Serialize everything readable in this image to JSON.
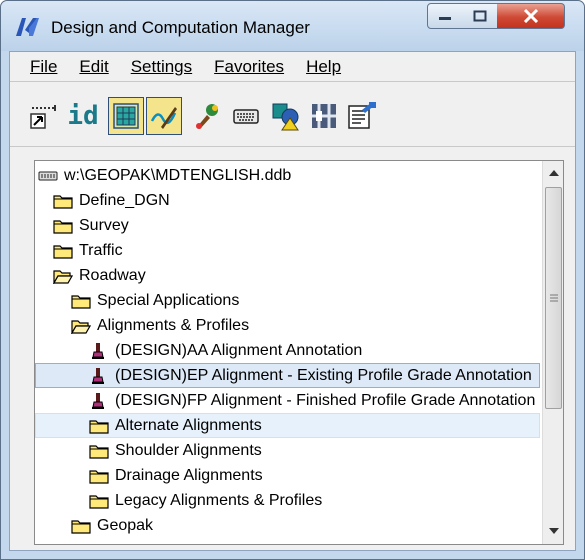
{
  "window": {
    "title": "Design and Computation Manager",
    "controls": [
      "minimize",
      "maximize",
      "close"
    ]
  },
  "menu": [
    {
      "label": "File"
    },
    {
      "label": "Edit"
    },
    {
      "label": "Settings"
    },
    {
      "label": "Favorites"
    },
    {
      "label": "Help"
    }
  ],
  "toolbar": {
    "id_label": "id",
    "buttons": [
      "place-element-icon",
      "id-icon",
      "dialog-icon",
      "draw-mode-icon",
      "paint-icon",
      "keyboard-icon",
      "shapes-icon",
      "grid-icon",
      "properties-icon"
    ],
    "active": [
      "dialog-icon",
      "draw-mode-icon"
    ]
  },
  "tree": {
    "items": [
      {
        "label": "w:\\GEOPAK\\MDTENGLISH.ddb",
        "icon": "database-icon",
        "level": 0
      },
      {
        "label": "Define_DGN",
        "icon": "folder-closed-icon",
        "level": 1
      },
      {
        "label": "Survey",
        "icon": "folder-closed-icon",
        "level": 1
      },
      {
        "label": "Traffic",
        "icon": "folder-closed-icon",
        "level": 1
      },
      {
        "label": "Roadway",
        "icon": "folder-open-icon",
        "level": 1
      },
      {
        "label": "Special Applications",
        "icon": "folder-closed-icon",
        "level": 2
      },
      {
        "label": "Alignments & Profiles",
        "icon": "folder-open-icon",
        "level": 2
      },
      {
        "label": "(DESIGN)AA Alignment Annotation",
        "icon": "pen-item-icon",
        "level": 3
      },
      {
        "label": "(DESIGN)EP Alignment - Existing Profile Grade Annotation",
        "icon": "pen-item-icon",
        "level": 3,
        "state": "selected"
      },
      {
        "label": "(DESIGN)FP Alignment - Finished Profile Grade Annotation",
        "icon": "pen-item-icon",
        "level": 3
      },
      {
        "label": "Alternate Alignments",
        "icon": "folder-closed-icon",
        "level": 3,
        "state": "hover"
      },
      {
        "label": "Shoulder Alignments",
        "icon": "folder-closed-icon",
        "level": 3
      },
      {
        "label": "Drainage Alignments",
        "icon": "folder-closed-icon",
        "level": 3
      },
      {
        "label": "Legacy Alignments & Profiles",
        "icon": "folder-closed-icon",
        "level": 3
      },
      {
        "label": "Geopak",
        "icon": "folder-closed-icon",
        "level": 2
      }
    ]
  },
  "scrollbar": {
    "up_icon": "scroll-up-icon",
    "down_icon": "scroll-down-icon",
    "position": 0.0,
    "visible_fraction": 0.62
  },
  "colors": {
    "folder": "#ffe97a",
    "selection": "#dde9f7",
    "hover": "#e7f1fb",
    "toolbar_active": "#f4e58c",
    "close_button": "#cf4a35"
  }
}
